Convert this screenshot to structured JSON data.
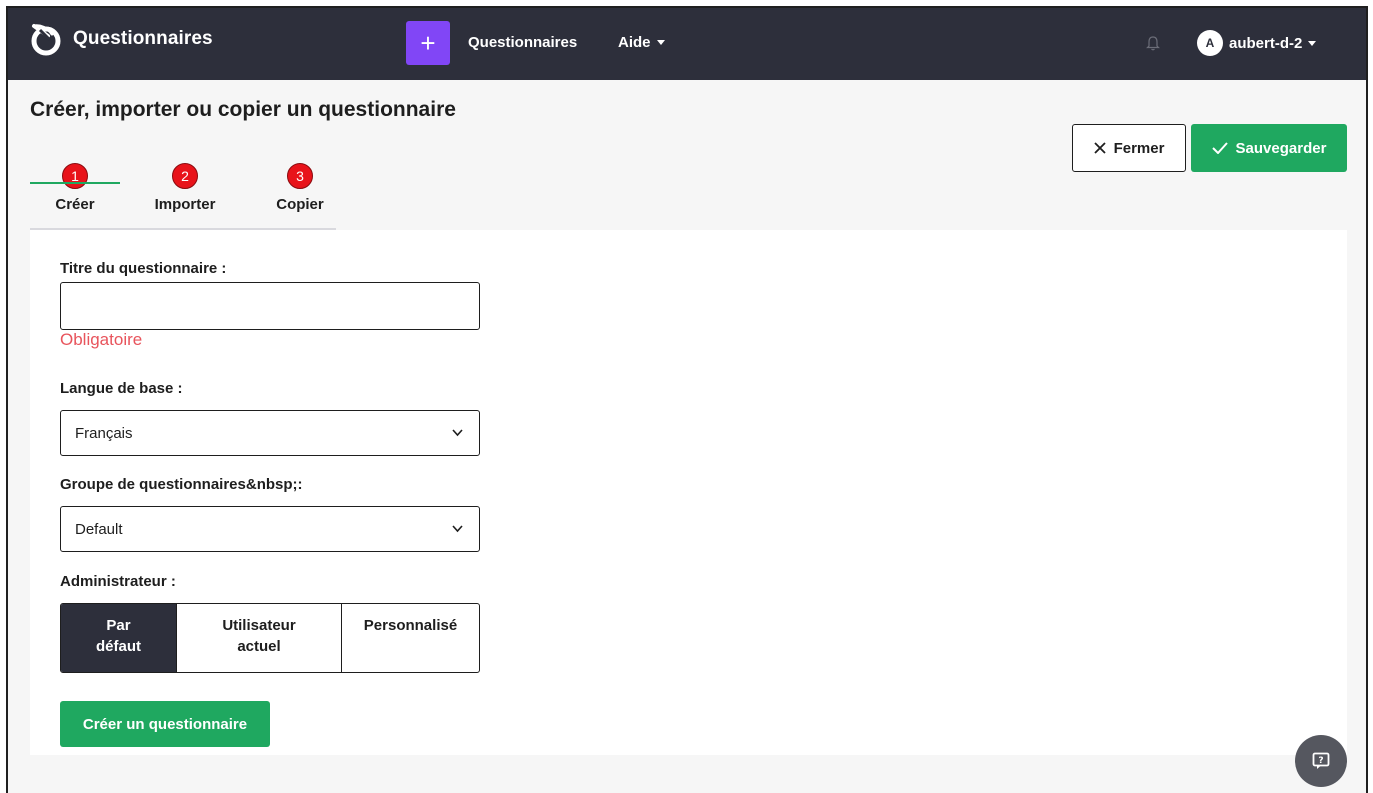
{
  "navbar": {
    "brand": "Questionnaires",
    "plus_label": "+",
    "links": {
      "questionnaires": "Questionnaires",
      "aide": "Aide"
    },
    "user": {
      "initial": "A",
      "name": "aubert-d-2"
    }
  },
  "page": {
    "title": "Créer, importer ou copier un questionnaire",
    "close_label": "Fermer",
    "save_label": "Sauvegarder"
  },
  "tabs": [
    {
      "num": "1",
      "label": "Créer",
      "active": true
    },
    {
      "num": "2",
      "label": "Importer",
      "active": false
    },
    {
      "num": "3",
      "label": "Copier",
      "active": false
    }
  ],
  "form": {
    "title_label": "Titre du questionnaire :",
    "title_value": "",
    "required_text": "Obligatoire",
    "language_label": "Langue de base :",
    "language_value": "Français",
    "group_label": "Groupe de questionnaires&nbsp;:",
    "group_value": "Default",
    "admin_label": "Administrateur :",
    "admin_options": [
      {
        "label_line1": "Par",
        "label_line2": "défaut",
        "selected": true
      },
      {
        "label_line1": "Utilisateur",
        "label_line2": "actuel",
        "selected": false
      },
      {
        "label_line1": "Personnalisé",
        "label_line2": "",
        "selected": false
      }
    ],
    "submit_label": "Créer un questionnaire"
  },
  "colors": {
    "navbar_bg": "#2d2f3b",
    "accent_purple": "#8146f6",
    "success_green": "#1fa860",
    "error_red": "#e8545c",
    "badge_red": "#e8131a"
  }
}
